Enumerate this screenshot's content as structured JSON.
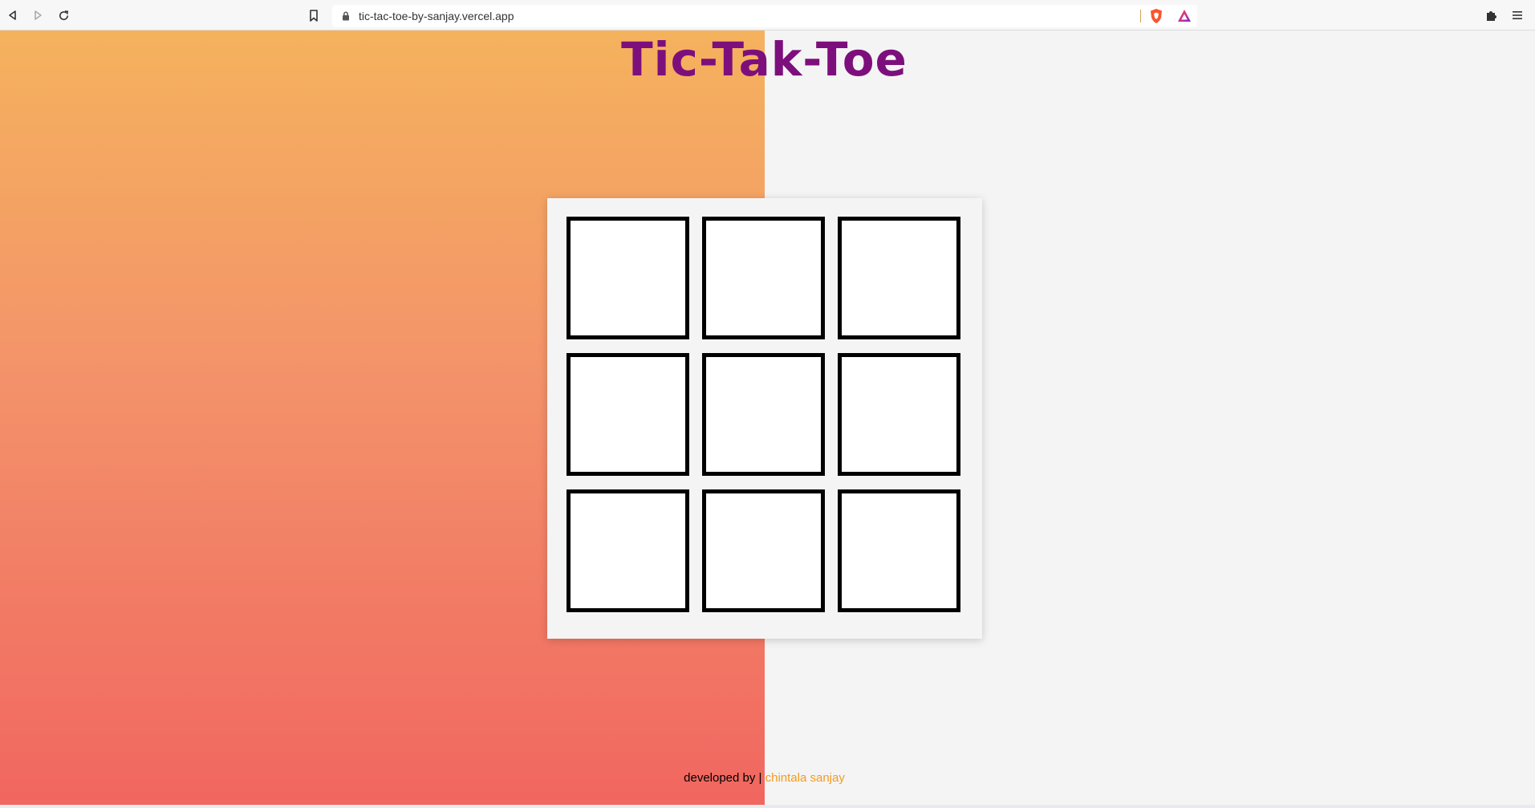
{
  "browser": {
    "url": "tic-tac-toe-by-sanjay.vercel.app",
    "icons": {
      "back": "back-arrow-icon",
      "forward": "forward-arrow-icon",
      "reload": "reload-icon",
      "bookmark": "bookmark-icon",
      "lock": "lock-icon",
      "shields": "brave-shields-icon",
      "rewards": "brave-rewards-icon",
      "extensions": "puzzle-icon",
      "menu": "hamburger-menu-icon"
    }
  },
  "game": {
    "title": "Tic-Tak-Toe",
    "cells": [
      "",
      "",
      "",
      "",
      "",
      "",
      "",
      "",
      ""
    ]
  },
  "footer": {
    "prefix": "developed by | ",
    "author": "chintala sanjay"
  },
  "colors": {
    "title": "#7d0f7d",
    "gradient_top": "#f5b25d",
    "gradient_bottom": "#f16660",
    "author_link": "#f39a1e"
  }
}
